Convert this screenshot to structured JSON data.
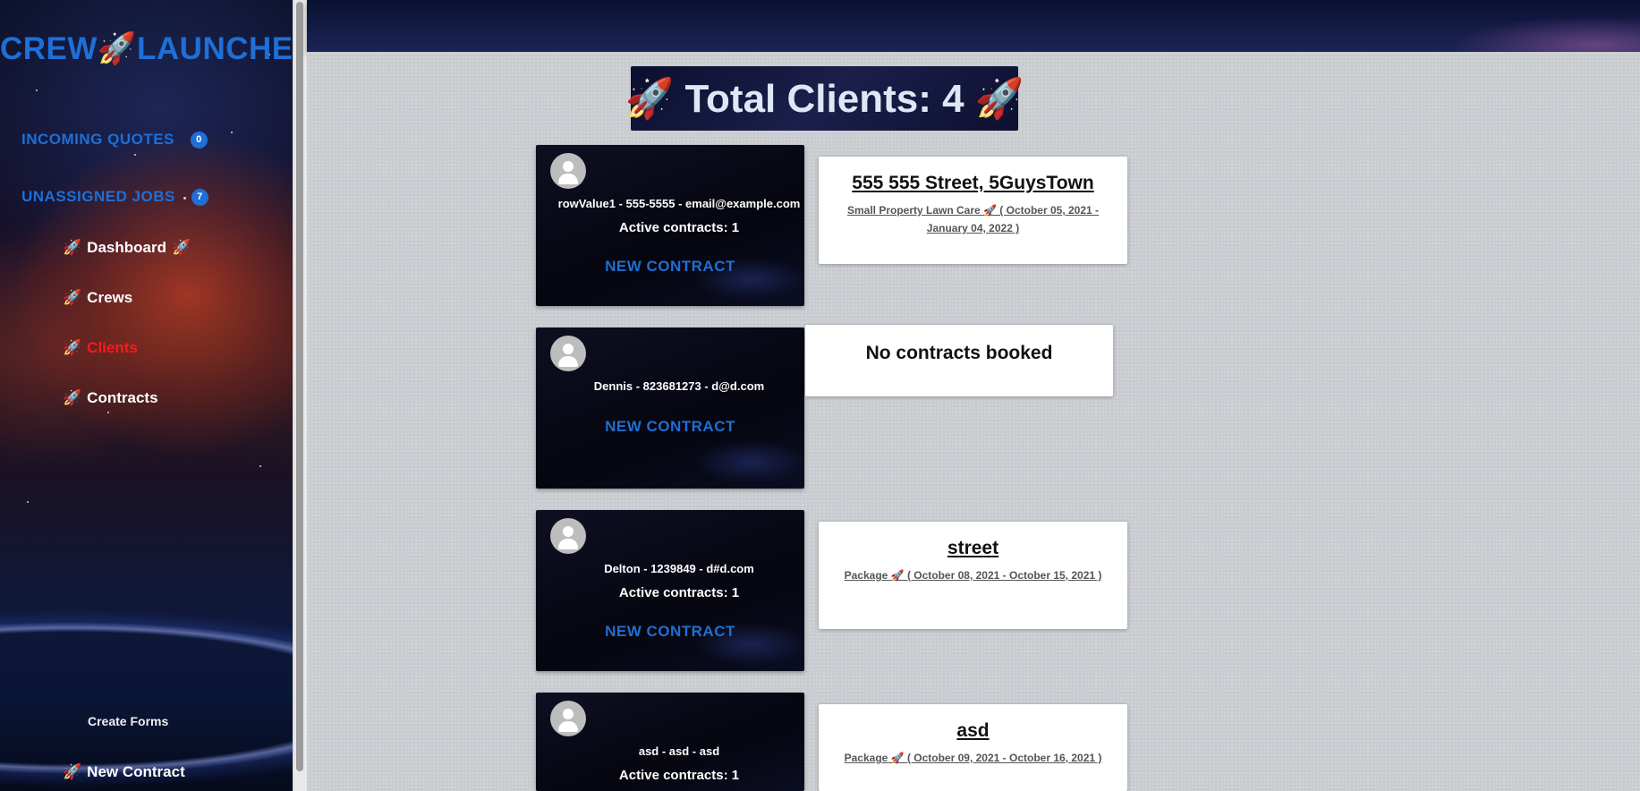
{
  "sidebar": {
    "brand": "CREW🚀LAUNCHER",
    "incoming_quotes": {
      "label": "INCOMING QUOTES",
      "count": "0"
    },
    "unassigned_jobs": {
      "label": "UNASSIGNED JOBS",
      "count": "7"
    },
    "nav": [
      {
        "icon": "🚀",
        "label": "Dashboard",
        "suffix": "🚀"
      },
      {
        "icon": "🚀",
        "label": "Crews",
        "suffix": ""
      },
      {
        "icon": "🚀",
        "label": "Clients",
        "suffix": "",
        "active": true
      },
      {
        "icon": "🚀",
        "label": "Contracts",
        "suffix": ""
      }
    ],
    "create_forms": "Create Forms",
    "new_contract": {
      "icon": "🚀",
      "label": "New Contract"
    }
  },
  "main": {
    "total": "🚀 Total Clients: 4 🚀",
    "new_contract_label": "NEW CONTRACT",
    "no_contracts": "No contracts booked",
    "clients": [
      {
        "info": "rowValue1 - 555-5555 - email@example.com",
        "active": "Active contracts: 1",
        "contract": {
          "title": "555 555 Street, 5GuysTown",
          "detail": "Small Property Lawn Care 🚀 ( October 05, 2021 - January 04, 2022 )"
        }
      },
      {
        "info": "Dennis - 823681273 - d@d.com",
        "active": "",
        "contract": null
      },
      {
        "info": "Delton - 1239849 - d#d.com",
        "active": "Active contracts: 1",
        "contract": {
          "title": "street",
          "detail": "Package 🚀 ( October 08, 2021 - October 15, 2021 )"
        }
      },
      {
        "info": "asd - asd - asd",
        "active": "Active contracts: 1",
        "contract": {
          "title": "asd",
          "detail": "Package 🚀 ( October 09, 2021 - October 16, 2021 )"
        }
      }
    ]
  },
  "colors": {
    "accent": "#1e6fd6",
    "active_nav": "#ff1a1a"
  }
}
